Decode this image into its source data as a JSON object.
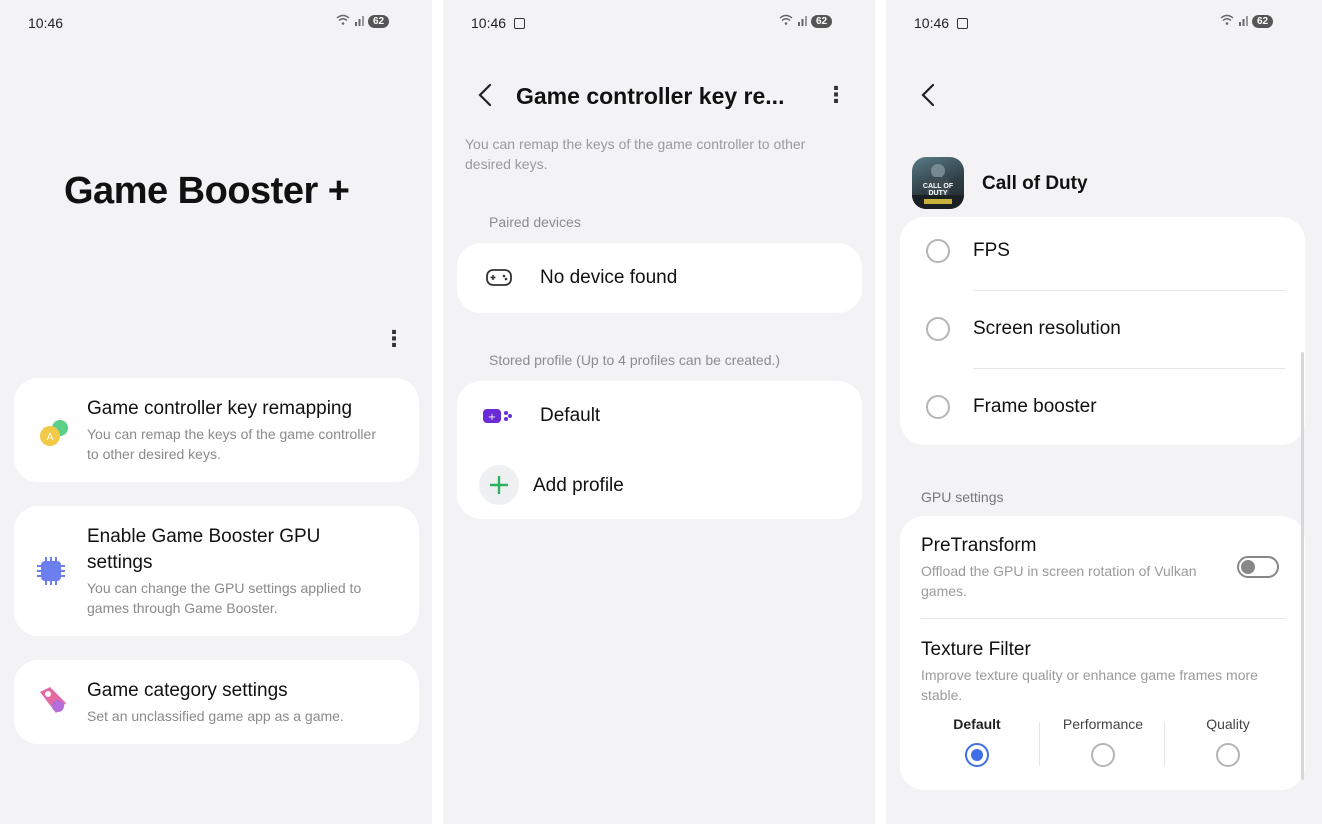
{
  "screen1": {
    "time": "10:46",
    "battery": "62",
    "title": "Game Booster +",
    "items": [
      {
        "title": "Game controller key remapping",
        "desc": "You can remap the keys of the game controller to other desired keys."
      },
      {
        "title": "Enable Game Booster GPU settings",
        "desc": "You can change the GPU settings applied to games through Game Booster."
      },
      {
        "title": "Game category settings",
        "desc": "Set an unclassified game app as a game."
      }
    ]
  },
  "screen2": {
    "time": "10:46",
    "battery": "62",
    "title": "Game controller key re...",
    "description": "You can remap the keys of the game controller to other desired keys.",
    "paired_label": "Paired devices",
    "no_device": "No device found",
    "stored_label": "Stored profile (Up to 4 profiles can be created.)",
    "profiles": [
      "Default"
    ],
    "add_profile": "Add profile"
  },
  "screen3": {
    "time": "10:46",
    "battery": "62",
    "app_name": "Call of Duty",
    "app_icon_text": "CALL OF DUTY",
    "options": [
      "FPS",
      "Screen resolution",
      "Frame booster"
    ],
    "gpu_label": "GPU settings",
    "pretransform": {
      "title": "PreTransform",
      "desc": "Offload the GPU in screen rotation of Vulkan games."
    },
    "texture": {
      "title": "Texture Filter",
      "desc": "Improve texture quality or enhance game frames more stable.",
      "choices": [
        "Default",
        "Performance",
        "Quality"
      ],
      "selected": "Default"
    }
  },
  "colors": {
    "accent": "#3e6fe6",
    "background": "#f3f3f5",
    "card": "#ffffff"
  }
}
